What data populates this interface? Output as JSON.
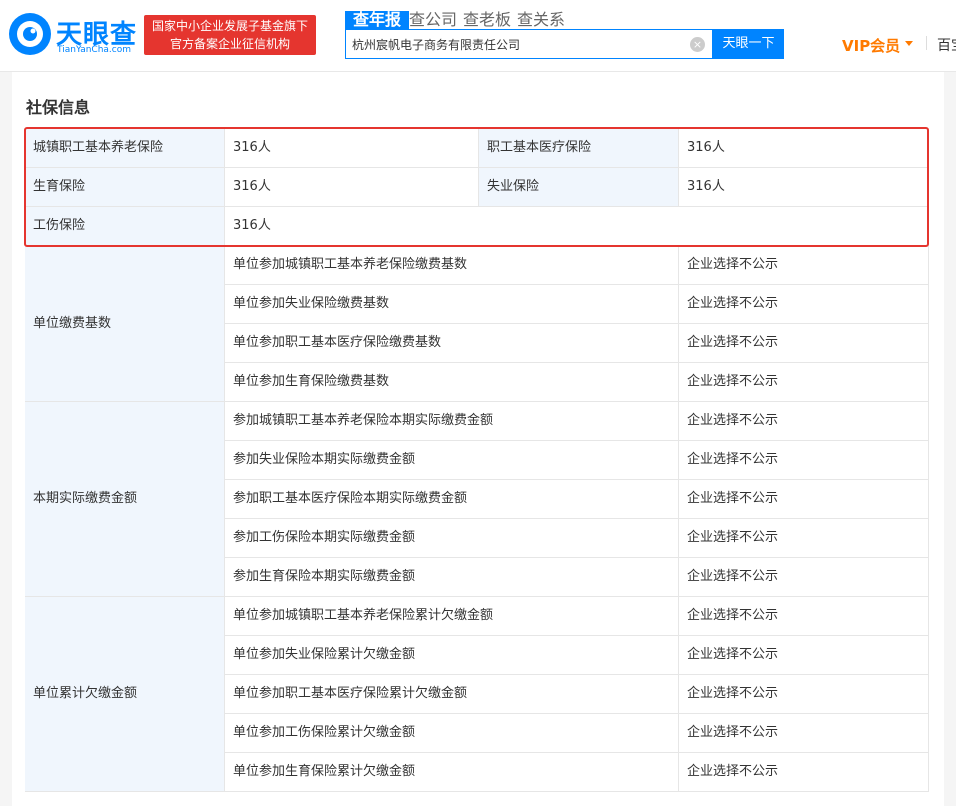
{
  "header": {
    "logo_title": "天眼查",
    "logo_sub": "TianYanCha.com",
    "badge_line1": "国家中小企业发展子基金旗下",
    "badge_line2": "官方备案企业征信机构",
    "tabs": [
      "查年报",
      "查公司",
      "查老板",
      "查关系"
    ],
    "search_value": "杭州宸帆电子商务有限责任公司",
    "search_button": "天眼一下",
    "vip_label": "VIP会员",
    "more_nav": "百宝"
  },
  "section_title": "社保信息",
  "summary": [
    {
      "label": "城镇职工基本养老保险",
      "value": "316人"
    },
    {
      "label": "职工基本医疗保险",
      "value": "316人"
    },
    {
      "label": "生育保险",
      "value": "316人"
    },
    {
      "label": "失业保险",
      "value": "316人"
    },
    {
      "label": "工伤保险",
      "value": "316人"
    }
  ],
  "groups": [
    {
      "label": "单位缴费基数",
      "rows": [
        {
          "item": "单位参加城镇职工基本养老保险缴费基数",
          "value": "企业选择不公示"
        },
        {
          "item": "单位参加失业保险缴费基数",
          "value": "企业选择不公示"
        },
        {
          "item": "单位参加职工基本医疗保险缴费基数",
          "value": "企业选择不公示"
        },
        {
          "item": "单位参加生育保险缴费基数",
          "value": "企业选择不公示"
        }
      ]
    },
    {
      "label": "本期实际缴费金额",
      "rows": [
        {
          "item": "参加城镇职工基本养老保险本期实际缴费金额",
          "value": "企业选择不公示"
        },
        {
          "item": "参加失业保险本期实际缴费金额",
          "value": "企业选择不公示"
        },
        {
          "item": "参加职工基本医疗保险本期实际缴费金额",
          "value": "企业选择不公示"
        },
        {
          "item": "参加工伤保险本期实际缴费金额",
          "value": "企业选择不公示"
        },
        {
          "item": "参加生育保险本期实际缴费金额",
          "value": "企业选择不公示"
        }
      ]
    },
    {
      "label": "单位累计欠缴金额",
      "rows": [
        {
          "item": "单位参加城镇职工基本养老保险累计欠缴金额",
          "value": "企业选择不公示"
        },
        {
          "item": "单位参加失业保险累计欠缴金额",
          "value": "企业选择不公示"
        },
        {
          "item": "单位参加职工基本医疗保险累计欠缴金额",
          "value": "企业选择不公示"
        },
        {
          "item": "单位参加工伤保险累计欠缴金额",
          "value": "企业选择不公示"
        },
        {
          "item": "单位参加生育保险累计欠缴金额",
          "value": "企业选择不公示"
        }
      ]
    }
  ],
  "colors": {
    "brand_blue": "#0084ff",
    "badge_red": "#e5352f",
    "vip_orange": "#ff7a00",
    "label_bg": "#f0f6fd"
  }
}
